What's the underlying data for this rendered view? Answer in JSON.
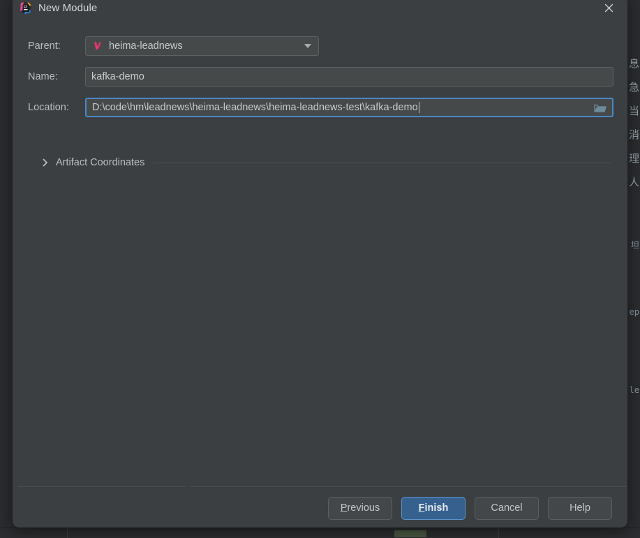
{
  "dialog": {
    "title": "New Module",
    "app_icon": "intellij-idea-icon",
    "close_icon": "close-icon"
  },
  "form": {
    "rows": [
      {
        "label": "Parent:",
        "type": "combobox",
        "value": "heima-leadnews",
        "icon": "maven-module-icon",
        "arrow_icon": "chevron-down-icon",
        "focused": false
      },
      {
        "label": "Name:",
        "type": "textfield",
        "value": "kafka-demo",
        "placeholder": "",
        "focused": false
      },
      {
        "label": "Location:",
        "type": "textfield-with-browse",
        "value": "D:\\code\\hm\\leadnews\\heima-leadnews\\heima-leadnews-test\\kafka-demo",
        "placeholder": "",
        "browse_icon": "folder-open-icon",
        "focused": true
      }
    ]
  },
  "artifact_section": {
    "label": "Artifact Coordinates",
    "chevron_icon": "chevron-right-icon",
    "expanded": false
  },
  "footer": {
    "buttons": [
      {
        "label": "Previous",
        "mnemonic": "P",
        "primary": false
      },
      {
        "label": "Finish",
        "mnemonic": "F",
        "primary": true
      },
      {
        "label": "Cancel",
        "mnemonic": "",
        "primary": false
      },
      {
        "label": "Help",
        "mnemonic": "",
        "primary": false
      }
    ]
  },
  "background": {
    "editor_cjk_lines": [
      "息",
      "急",
      "当",
      "消",
      "理",
      "人"
    ],
    "editor_fragments": [
      "坦",
      "ep",
      "le"
    ]
  },
  "colors": {
    "dialog_background": "#3c3f41",
    "ide_background": "#2b2d30",
    "field_background": "#45494a",
    "field_border": "#5c6164",
    "focus_border": "#4a88c7",
    "primary_button": "#36618f",
    "text": "#c8cbcd",
    "label_text": "#bcbfc2",
    "maven_icon": "#e8356d",
    "folder_icon": "#6d8b99"
  }
}
